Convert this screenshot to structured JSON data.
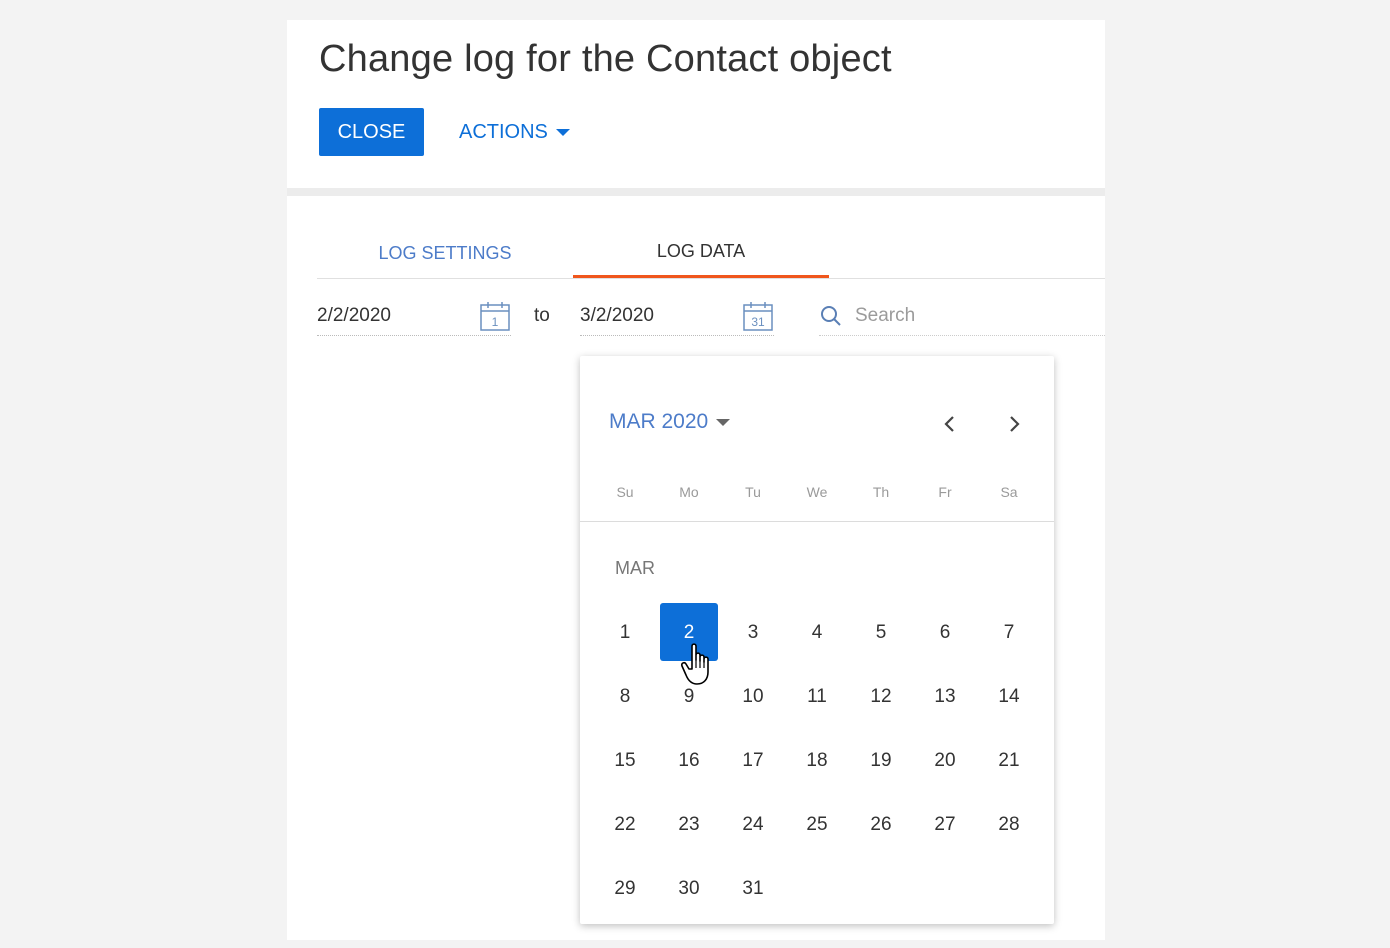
{
  "page": {
    "title": "Change log for the Contact object"
  },
  "toolbar": {
    "close_label": "CLOSE",
    "actions_label": "ACTIONS"
  },
  "tabs": [
    {
      "label": "LOG SETTINGS",
      "active": false
    },
    {
      "label": "LOG DATA",
      "active": true
    }
  ],
  "filter": {
    "date_from": "2/2/2020",
    "date_from_icon_day": "1",
    "to_label": "to",
    "date_to": "3/2/2020",
    "date_to_icon_day": "31",
    "search_placeholder": "Search"
  },
  "calendar": {
    "month_year_label": "MAR 2020",
    "weekdays": [
      "Su",
      "Mo",
      "Tu",
      "We",
      "Th",
      "Fr",
      "Sa"
    ],
    "month_label": "MAR",
    "selected_day": "2",
    "weeks": [
      [
        "1",
        "2",
        "3",
        "4",
        "5",
        "6",
        "7"
      ],
      [
        "8",
        "9",
        "10",
        "11",
        "12",
        "13",
        "14"
      ],
      [
        "15",
        "16",
        "17",
        "18",
        "19",
        "20",
        "21"
      ],
      [
        "22",
        "23",
        "24",
        "25",
        "26",
        "27",
        "28"
      ],
      [
        "29",
        "30",
        "31",
        "",
        "",
        "",
        ""
      ]
    ]
  },
  "colors": {
    "accent": "#0d6fd8",
    "tab_indicator": "#f0561c",
    "link": "#4d7cc9"
  }
}
